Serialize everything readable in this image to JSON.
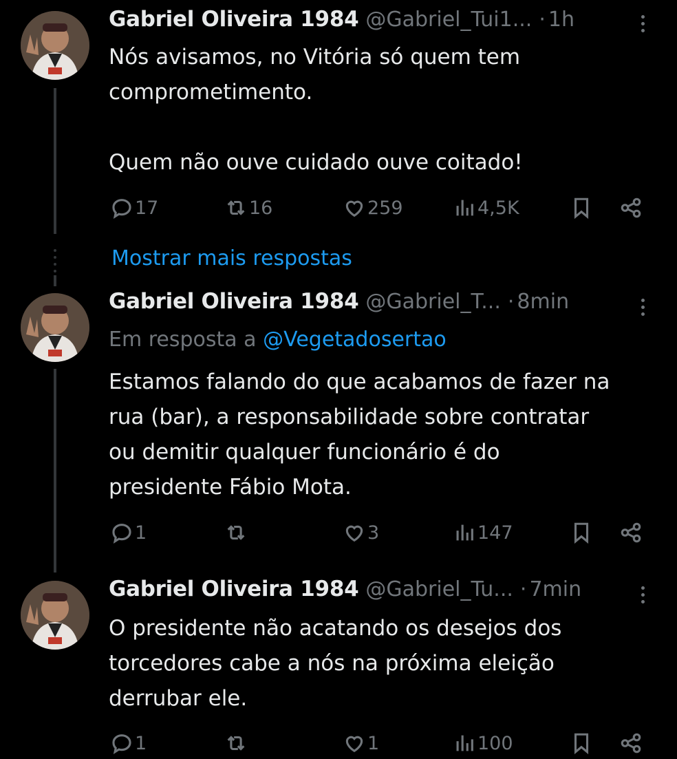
{
  "colors": {
    "background": "#000000",
    "text": "#e7e9ea",
    "muted": "#71767b",
    "link": "#1d9bf0",
    "thread_line": "#333639"
  },
  "tweets": [
    {
      "name": "Gabriel Oliveira 1984",
      "handle": "@Gabriel_Tui1...",
      "dot": "·",
      "time": "1h",
      "text": "Nós avisamos, no Vitória só quem tem\ncomprometimento.\n\nQuem não ouve cuidado ouve coitado!",
      "replies": "17",
      "retweets": "16",
      "likes": "259",
      "views": "4,5K"
    },
    {
      "name": "Gabriel Oliveira 1984",
      "handle": "@Gabriel_T...",
      "dot": "·",
      "time": "8min",
      "reply_to_label": "Em resposta a",
      "reply_to_user": "@Vegetadosertao",
      "text": "Estamos falando do que acabamos de fazer na\nrua (bar), a responsabilidade sobre contratar\nou demitir qualquer funcionário é do\npresidente Fábio Mota.",
      "replies": "1",
      "retweets": "",
      "likes": "3",
      "views": "147"
    },
    {
      "name": "Gabriel Oliveira 1984",
      "handle": "@Gabriel_Tu...",
      "dot": "·",
      "time": "7min",
      "text": "O presidente não acatando os desejos dos\ntorcedores cabe a nós na próxima eleição\nderrubar ele.",
      "replies": "1",
      "retweets": "",
      "likes": "1",
      "views": "100"
    }
  ],
  "show_more_replies": "Mostrar mais respostas",
  "icons": {
    "reply": "reply-icon",
    "retweet": "retweet-icon",
    "like": "heart-icon",
    "views": "views-chart-icon",
    "bookmark": "bookmark-icon",
    "share": "share-icon",
    "more": "more-options-icon"
  }
}
